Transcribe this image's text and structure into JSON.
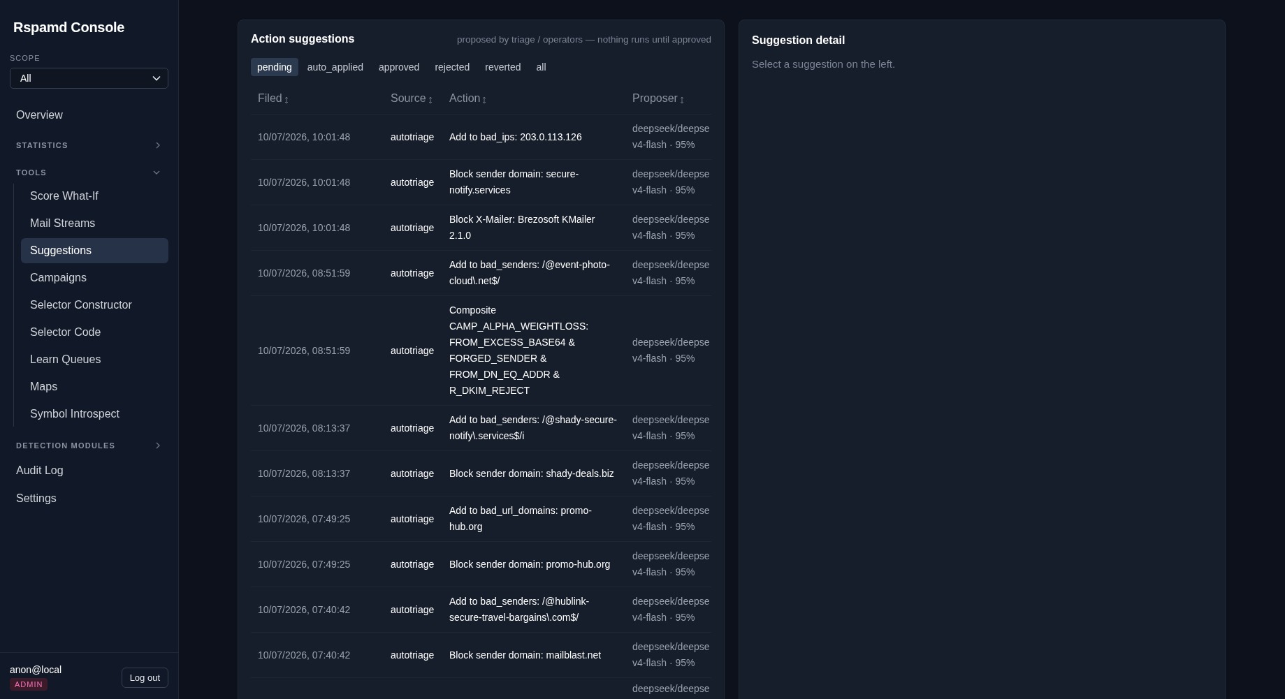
{
  "sidebar": {
    "title": "Rspamd Console",
    "scope": {
      "label": "SCOPE",
      "value": "All"
    },
    "nav": [
      {
        "kind": "link",
        "label": "Overview",
        "selected": false
      },
      {
        "kind": "group",
        "label": "STATISTICS",
        "expanded": false
      },
      {
        "kind": "group",
        "label": "TOOLS",
        "expanded": true,
        "children": [
          {
            "label": "Score What-If",
            "selected": false
          },
          {
            "label": "Mail Streams",
            "selected": false
          },
          {
            "label": "Suggestions",
            "selected": true
          },
          {
            "label": "Campaigns",
            "selected": false
          },
          {
            "label": "Selector Constructor",
            "selected": false
          },
          {
            "label": "Selector Code",
            "selected": false
          },
          {
            "label": "Learn Queues",
            "selected": false
          },
          {
            "label": "Maps",
            "selected": false
          },
          {
            "label": "Symbol Introspect",
            "selected": false
          }
        ]
      },
      {
        "kind": "group",
        "label": "DETECTION MODULES",
        "expanded": false
      },
      {
        "kind": "link",
        "label": "Audit Log",
        "selected": false
      },
      {
        "kind": "link",
        "label": "Settings",
        "selected": false
      }
    ],
    "user": {
      "name": "anon@local",
      "role": "ADMIN",
      "logout": "Log out"
    }
  },
  "suggestions": {
    "title": "Action suggestions",
    "note": "proposed by triage / operators — nothing runs until approved",
    "tabs": [
      {
        "label": "pending",
        "selected": true
      },
      {
        "label": "auto_applied",
        "selected": false
      },
      {
        "label": "approved",
        "selected": false
      },
      {
        "label": "rejected",
        "selected": false
      },
      {
        "label": "reverted",
        "selected": false
      },
      {
        "label": "all",
        "selected": false
      }
    ],
    "columns": [
      "Filed",
      "Source",
      "Action",
      "Proposer"
    ],
    "rows": [
      {
        "filed": "10/07/2026, 10:01:48",
        "source": "autotriage",
        "action": "Add to bad_ips: 203.0.113.126",
        "proposer": "deepseek/deepse",
        "proposer_detail": "v4-flash · 95%"
      },
      {
        "filed": "10/07/2026, 10:01:48",
        "source": "autotriage",
        "action": "Block sender domain: secure-notify.services",
        "proposer": "deepseek/deepse",
        "proposer_detail": "v4-flash · 95%"
      },
      {
        "filed": "10/07/2026, 10:01:48",
        "source": "autotriage",
        "action": "Block X-Mailer: Brezosoft KMailer 2.1.0",
        "proposer": "deepseek/deepse",
        "proposer_detail": "v4-flash · 95%"
      },
      {
        "filed": "10/07/2026, 08:51:59",
        "source": "autotriage",
        "action": "Add to bad_senders: /@event-photo-cloud\\.net$/",
        "proposer": "deepseek/deepse",
        "proposer_detail": "v4-flash · 95%"
      },
      {
        "filed": "10/07/2026, 08:51:59",
        "source": "autotriage",
        "action": "Composite CAMP_ALPHA_WEIGHTLOSS: FROM_EXCESS_BASE64 & FORGED_SENDER & FROM_DN_EQ_ADDR & R_DKIM_REJECT",
        "proposer": "deepseek/deepse",
        "proposer_detail": "v4-flash · 95%"
      },
      {
        "filed": "10/07/2026, 08:13:37",
        "source": "autotriage",
        "action": "Add to bad_senders: /@shady-secure-notify\\.services$/i",
        "proposer": "deepseek/deepse",
        "proposer_detail": "v4-flash · 95%"
      },
      {
        "filed": "10/07/2026, 08:13:37",
        "source": "autotriage",
        "action": "Block sender domain: shady-deals.biz",
        "proposer": "deepseek/deepse",
        "proposer_detail": "v4-flash · 95%"
      },
      {
        "filed": "10/07/2026, 07:49:25",
        "source": "autotriage",
        "action": "Add to bad_url_domains: promo-hub.org",
        "proposer": "deepseek/deepse",
        "proposer_detail": "v4-flash · 95%"
      },
      {
        "filed": "10/07/2026, 07:49:25",
        "source": "autotriage",
        "action": "Block sender domain: promo-hub.org",
        "proposer": "deepseek/deepse",
        "proposer_detail": "v4-flash · 95%"
      },
      {
        "filed": "10/07/2026, 07:40:42",
        "source": "autotriage",
        "action": "Add to bad_senders: /@hublink-secure-travel-bargains\\.com$/",
        "proposer": "deepseek/deepse",
        "proposer_detail": "v4-flash · 95%"
      },
      {
        "filed": "10/07/2026, 07:40:42",
        "source": "autotriage",
        "action": "Block sender domain: mailblast.net",
        "proposer": "deepseek/deepse",
        "proposer_detail": "v4-flash · 95%"
      },
      {
        "proposer": "deepseek/deepse"
      }
    ]
  },
  "detail": {
    "title": "Suggestion detail",
    "empty": "Select a suggestion on the left."
  }
}
